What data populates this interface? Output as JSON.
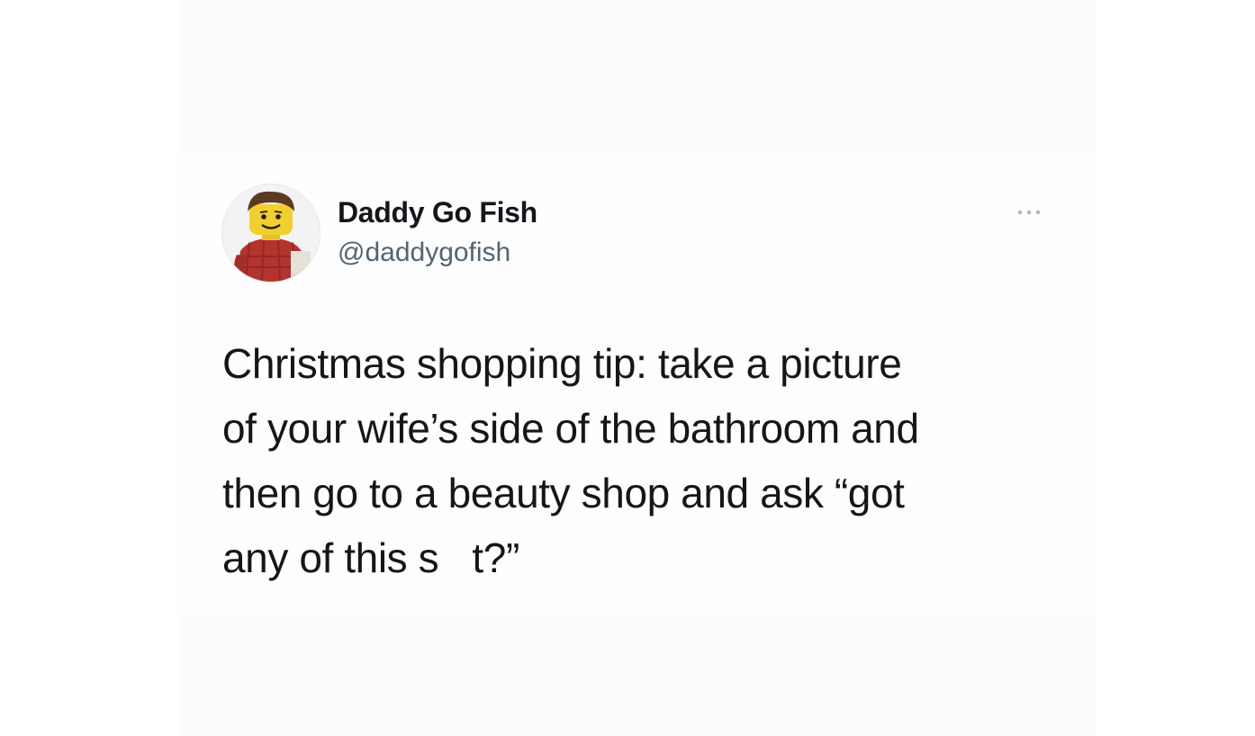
{
  "tweet": {
    "author": {
      "display_name": "Daddy Go Fish",
      "handle": "@daddygofish",
      "avatar": "lego-minifigure-avatar"
    },
    "more_icon": "ellipsis-icon",
    "text_lines": [
      "Christmas shopping tip: take a picture",
      "of your wife’s side of the bathroom and",
      "then go to a beauty shop and ask “got",
      "any of this s   t?”"
    ]
  },
  "colors": {
    "text_primary": "#14171a",
    "text_secondary": "#536471",
    "background": "#ffffff"
  }
}
